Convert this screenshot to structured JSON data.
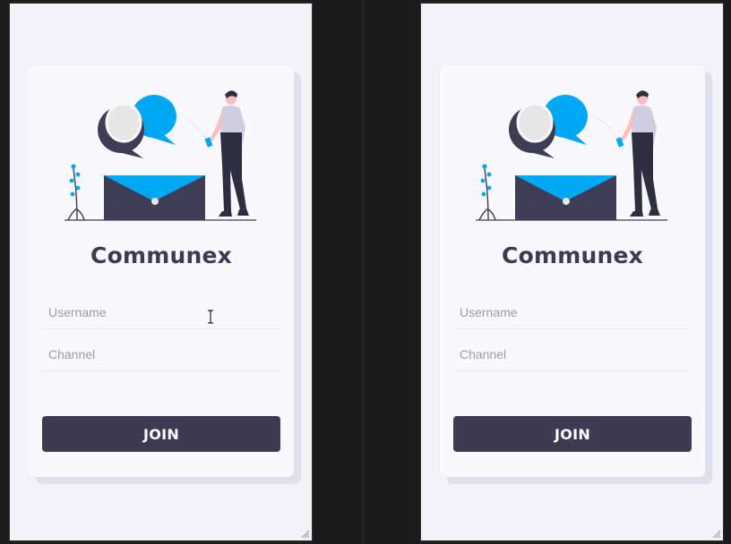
{
  "app": {
    "title": "Communex",
    "username_placeholder": "Username",
    "channel_placeholder": "Channel",
    "join_label": "JOIN"
  },
  "colors": {
    "accent": "#00a8f3",
    "dark": "#3d3a52",
    "card_bg": "#f9f9fd",
    "window_bg": "#f2f2f8"
  },
  "icons": [
    "chat-bubbles-illustration",
    "envelope-illustration",
    "person-with-phone-illustration",
    "plant-illustration",
    "text-cursor-icon",
    "resize-grip-icon"
  ]
}
